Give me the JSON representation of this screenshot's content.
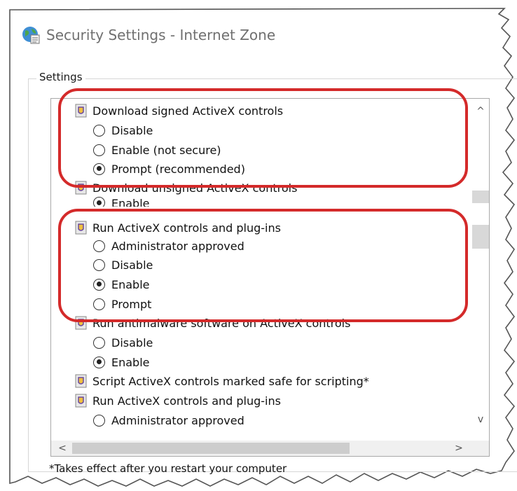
{
  "window": {
    "title": "Security Settings - Internet Zone",
    "icon": "globe-icon"
  },
  "settings_group": {
    "label": "Settings",
    "rows": [
      {
        "kind": "category",
        "label": "Download signed ActiveX controls"
      },
      {
        "kind": "option",
        "label": "Disable",
        "selected": false
      },
      {
        "kind": "option",
        "label": "Enable (not secure)",
        "selected": false
      },
      {
        "kind": "option",
        "label": "Prompt (recommended)",
        "selected": true
      },
      {
        "kind": "category",
        "label": "Download unsigned ActiveX controls"
      },
      {
        "kind": "option",
        "label": "Enable",
        "selected": true
      },
      {
        "kind": "category",
        "label": "Run ActiveX controls and plug-ins"
      },
      {
        "kind": "option",
        "label": "Administrator approved",
        "selected": false
      },
      {
        "kind": "option",
        "label": "Disable",
        "selected": false
      },
      {
        "kind": "option",
        "label": "Enable",
        "selected": true
      },
      {
        "kind": "option",
        "label": "Prompt",
        "selected": false
      },
      {
        "kind": "category",
        "label": "Run antimalware software on ActiveX controls"
      },
      {
        "kind": "option",
        "label": "Disable",
        "selected": false
      },
      {
        "kind": "option",
        "label": "Enable",
        "selected": true
      },
      {
        "kind": "category",
        "label": "Script ActiveX controls marked safe for scripting*"
      },
      {
        "kind": "category",
        "label": "Run ActiveX controls and plug-ins"
      },
      {
        "kind": "option",
        "label": "Administrator approved",
        "selected": false
      }
    ]
  },
  "scrollbars": {
    "up_arrow": "^",
    "down_arrow": "v",
    "left_arrow": "<",
    "right_arrow": ">"
  },
  "footnote": "*Takes effect after you restart your computer",
  "colors": {
    "highlight": "#d42a2a",
    "title_text": "#707070"
  }
}
